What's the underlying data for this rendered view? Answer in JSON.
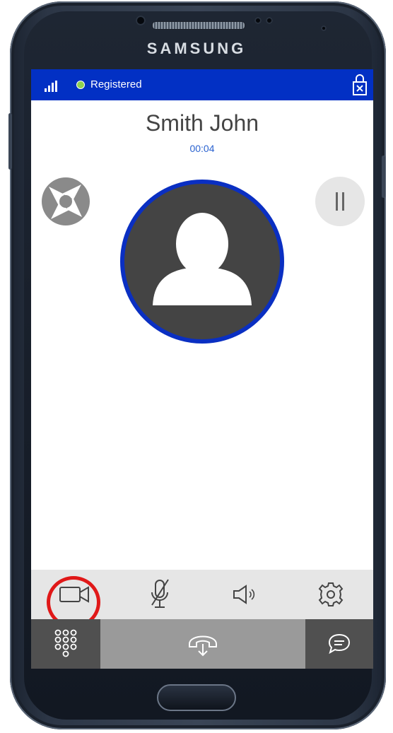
{
  "device": {
    "brand": "SAMSUNG"
  },
  "status_bar": {
    "registration_status": "Registered",
    "status_color": "#8fd14f",
    "accent": "#0230c4"
  },
  "call": {
    "caller_name": "Smith John",
    "duration": "00:04"
  },
  "actions": {
    "snapshot": "shutter-icon",
    "hold": "pause-icon"
  },
  "toolbar": {
    "items": [
      {
        "icon": "video-camera-icon",
        "highlighted": true
      },
      {
        "icon": "microphone-muted-icon"
      },
      {
        "icon": "speaker-icon"
      },
      {
        "icon": "gear-icon"
      }
    ]
  },
  "bottom_bar": {
    "items": [
      {
        "icon": "dialpad-icon"
      },
      {
        "icon": "hang-up-icon"
      },
      {
        "icon": "chat-icon"
      }
    ]
  },
  "highlight_color": "#e01818"
}
